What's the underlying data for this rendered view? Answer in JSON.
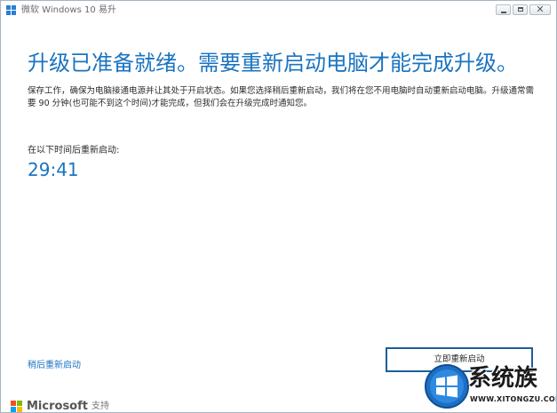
{
  "window": {
    "title": "微软 Windows 10 易升",
    "icon": "windows-logo-icon",
    "controls": {
      "minimize_icon": "minimize-icon",
      "maximize_icon": "maximize-icon",
      "close_glyph": "✕"
    }
  },
  "main": {
    "headline": "升级已准备就绪。需要重新启动电脑才能完成升级。",
    "description": "保存工作，确保为电脑接通电源并让其处于开启状态。如果您选择稍后重新启动，我们将在您不用电脑时自动重新启动电脑。升级通常需要 90 分钟(也可能不到这个时间)才能完成，但我们会在升级完成时通知您。",
    "countdown_label": "在以下时间后重新启动:",
    "countdown": "29:41"
  },
  "actions": {
    "restart_later": "稍后重新启动",
    "restart_now": "立即重新启动"
  },
  "footer": {
    "brand": "Microsoft",
    "support": "支持"
  },
  "watermark": {
    "text": "系统族",
    "url": "WWW.XITONGZU.COM"
  },
  "colors": {
    "accent": "#1a74c0",
    "button_border": "#1e5e9a",
    "text": "#2b2b2b",
    "ms_red": "#f25022",
    "ms_green": "#7fba00",
    "ms_blue": "#00a4ef",
    "ms_yellow": "#ffb900"
  }
}
